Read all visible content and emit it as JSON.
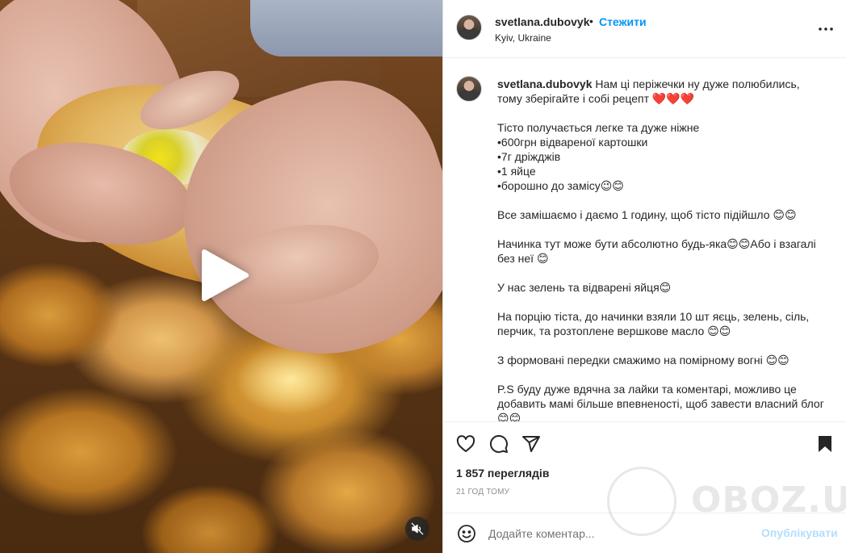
{
  "post": {
    "username": "svetlana.dubovyk",
    "separator": "•",
    "follow_label": "Стежити",
    "location": "Kyiv, Ukraine",
    "more_icon": "more-horizontal-icon"
  },
  "caption": {
    "username": "svetlana.dubovyk",
    "text": " Нам ці періжечки ну дуже полюбились, тому зберігайте і собі рецепт ❤️❤️❤️\n\nТісто получається легке та дуже ніжне\n•600грн відвареної картошки\n•7г дріжджів\n•1 яйце\n•борошно до замісу😉😊\n\nВсе замішаємо і даємо 1 годину, щоб тісто підійшло 😊😊\n\nНачинка тут може бути абсолютно будь-яка😊😊Або і взагалі без неї 😊\n\nУ нас зелень та відварені яйця😊\n\nНа порцію тіста, до начинки взяли 10 шт яєць, зелень, сіль, перчик, та розтоплене вершкове масло 😊😊\n\nЗ формовані передки смажимо на помірному вогні 😊😊\n\nP.S буду дуже вдячна за лайки та коментарі, можливо це добавить мамі більше впевненості, щоб завести власний блог😊😊\n😊"
  },
  "stats": {
    "views": "1 857 переглядів",
    "time_ago": "21 ГОД ТОМУ"
  },
  "comment": {
    "placeholder": "Додайте коментар...",
    "post_label": "Опублікувати"
  },
  "watermark": {
    "text": "OBOZ.UA"
  },
  "icons": {
    "like": "heart-icon",
    "comment": "comment-icon",
    "share": "share-icon",
    "save": "bookmark-icon",
    "emoji": "emoji-icon",
    "play": "play-icon",
    "mute": "muted-speaker-icon"
  },
  "colors": {
    "link": "#0095f6",
    "text": "#262626",
    "muted": "#8e8e8e",
    "post_disabled": "#b2dffc"
  }
}
